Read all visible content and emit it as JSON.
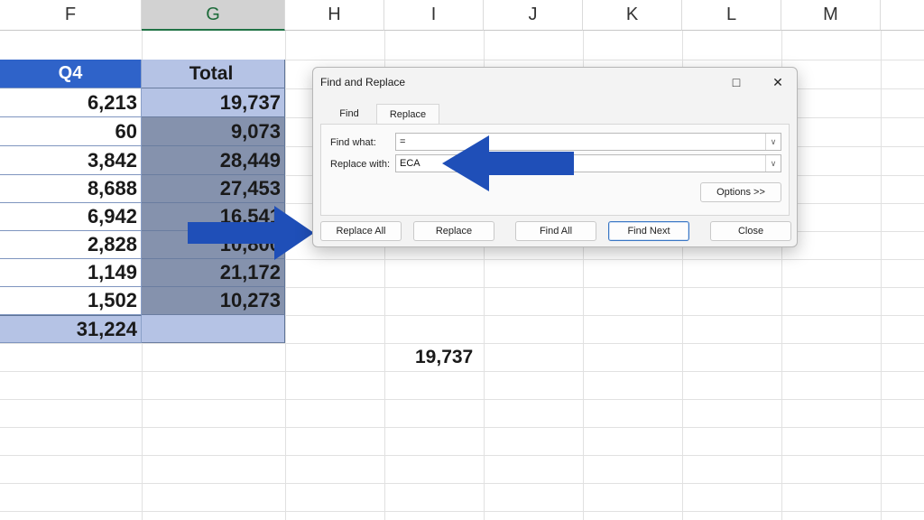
{
  "columns": [
    {
      "label": "F",
      "selected": false
    },
    {
      "label": "G",
      "selected": true
    },
    {
      "label": "H",
      "selected": false
    },
    {
      "label": "I",
      "selected": false
    },
    {
      "label": "J",
      "selected": false
    },
    {
      "label": "K",
      "selected": false
    },
    {
      "label": "L",
      "selected": false
    },
    {
      "label": "M",
      "selected": false
    }
  ],
  "table": {
    "header_q4": "Q4",
    "header_total": "Total",
    "rows": [
      {
        "q4": "6,213",
        "total": "19,737"
      },
      {
        "q4": "60",
        "total": "9,073"
      },
      {
        "q4": "3,842",
        "total": "28,449"
      },
      {
        "q4": "8,688",
        "total": "27,453"
      },
      {
        "q4": "6,942",
        "total": "16,541"
      },
      {
        "q4": "2,828",
        "total": "10,800"
      },
      {
        "q4": "1,149",
        "total": "21,172"
      },
      {
        "q4": "1,502",
        "total": "10,273"
      }
    ],
    "sum_q4": "31,224"
  },
  "free_cell_value": "19,737",
  "dialog": {
    "title": "Find and Replace",
    "tabs": [
      {
        "label": "Find",
        "active": false
      },
      {
        "label": "Replace",
        "active": true
      }
    ],
    "find_what_label": "Find what:",
    "find_what_value": "=",
    "replace_with_label": "Replace with:",
    "replace_with_value": "ECA",
    "options_button": "Options >>",
    "buttons": {
      "replace_all": "Replace All",
      "replace": "Replace",
      "find_all": "Find All",
      "find_next": "Find Next",
      "close": "Close"
    }
  },
  "colors": {
    "header_blue": "#2f63c9",
    "selection_fill": "#8592ad",
    "arrow_blue": "#1f4fb8",
    "excel_green": "#217346"
  }
}
